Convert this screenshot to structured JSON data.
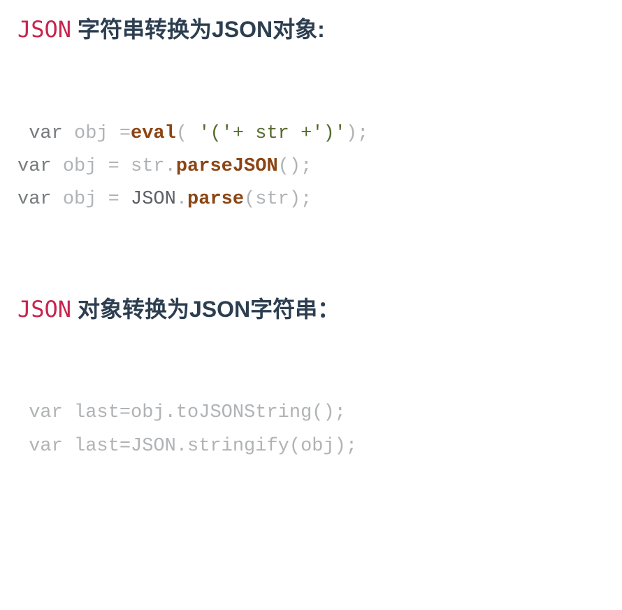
{
  "section1": {
    "json_label": "JSON",
    "title": " 字符串转换为JSON对象:",
    "code": {
      "line1": {
        "l": " ",
        "kw": "var",
        "sp1": " ",
        "ident1": "obj",
        "sp2": " ",
        "op": "=",
        "func": "eval",
        "paren_o": "(",
        "sp3": " ",
        "str": "'('+ str +')'",
        "paren_c": ")",
        "semi": ";"
      },
      "line2": {
        "kw": "var",
        "sp1": " ",
        "ident1": "obj",
        "sp2": " ",
        "op": "=",
        "sp3": " ",
        "ident2": "str",
        "dot": ".",
        "func": "parseJSON",
        "paren": "()",
        "semi": ";"
      },
      "line3": {
        "kw": "var",
        "sp1": " ",
        "ident1": "obj",
        "sp2": " ",
        "op": "=",
        "sp3": " ",
        "lit": "JSON",
        "dot": ".",
        "func": "parse",
        "paren_o": "(",
        "ident2": "str",
        "paren_c": ")",
        "semi": ";"
      }
    }
  },
  "section2": {
    "json_label": "JSON",
    "title": "  对象转换为JSON字符串：",
    "code": {
      "line1": " var last=obj.toJSONString();",
      "line2": " var last=JSON.stringify(obj);"
    }
  }
}
